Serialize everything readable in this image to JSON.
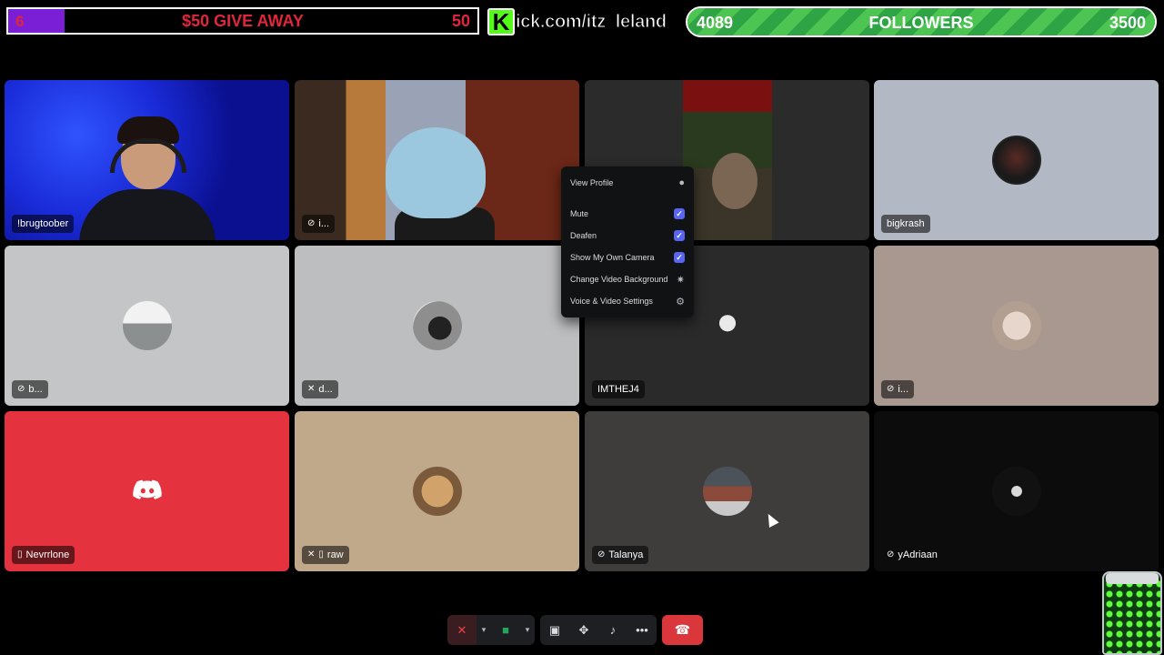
{
  "overlay": {
    "giveaway": {
      "current": "6",
      "title": "$50 GIVE AWAY",
      "goal": "50",
      "progress": 0.12,
      "accent": "#7a1fd6",
      "text_color": "#e0263c"
    },
    "kick": {
      "logo_letter": "K",
      "url_text": "ick.com/itz_leland",
      "brand_color": "#53fc18"
    },
    "followers": {
      "current": "4089",
      "title": "FOLLOWERS",
      "goal": "3500",
      "progress": 1.0,
      "color": "#4ec552"
    }
  },
  "participants": [
    {
      "name": "!brugtoober",
      "status_icon": "none"
    },
    {
      "name": "i...",
      "status_icon": "muted-icon"
    },
    {
      "name": "",
      "status_icon": "none"
    },
    {
      "name": "bigkrash",
      "status_icon": "none"
    },
    {
      "name": "b...",
      "status_icon": "muted-icon"
    },
    {
      "name": "d...",
      "status_icon": "muted-mic-icon"
    },
    {
      "name": "IMTHEJ4",
      "status_icon": "none"
    },
    {
      "name": "i...",
      "status_icon": "muted-icon"
    },
    {
      "name": "Nevrrlone",
      "status_icon": "mobile-icon"
    },
    {
      "name": "raw",
      "status_icon": "muted-mic-mobile-icon"
    },
    {
      "name": "Talanya",
      "status_icon": "muted-icon"
    },
    {
      "name": "yAdriaan",
      "status_icon": "muted-icon"
    }
  ],
  "context_menu": {
    "items": [
      {
        "label": "View Profile",
        "icon": "person-icon"
      },
      {
        "label": "Mute",
        "checked": true
      },
      {
        "label": "Deafen",
        "checked": true
      },
      {
        "label": "Show My Own Camera",
        "checked": true
      },
      {
        "label": "Change Video Background",
        "icon": "sparkle-icon"
      },
      {
        "label": "Voice & Video Settings",
        "icon": "gear-icon"
      }
    ],
    "check_color": "#5865f2"
  },
  "controls": {
    "mic_color": "#f23f43",
    "camera_color": "#23a55a",
    "hangup_color": "#da373c"
  }
}
